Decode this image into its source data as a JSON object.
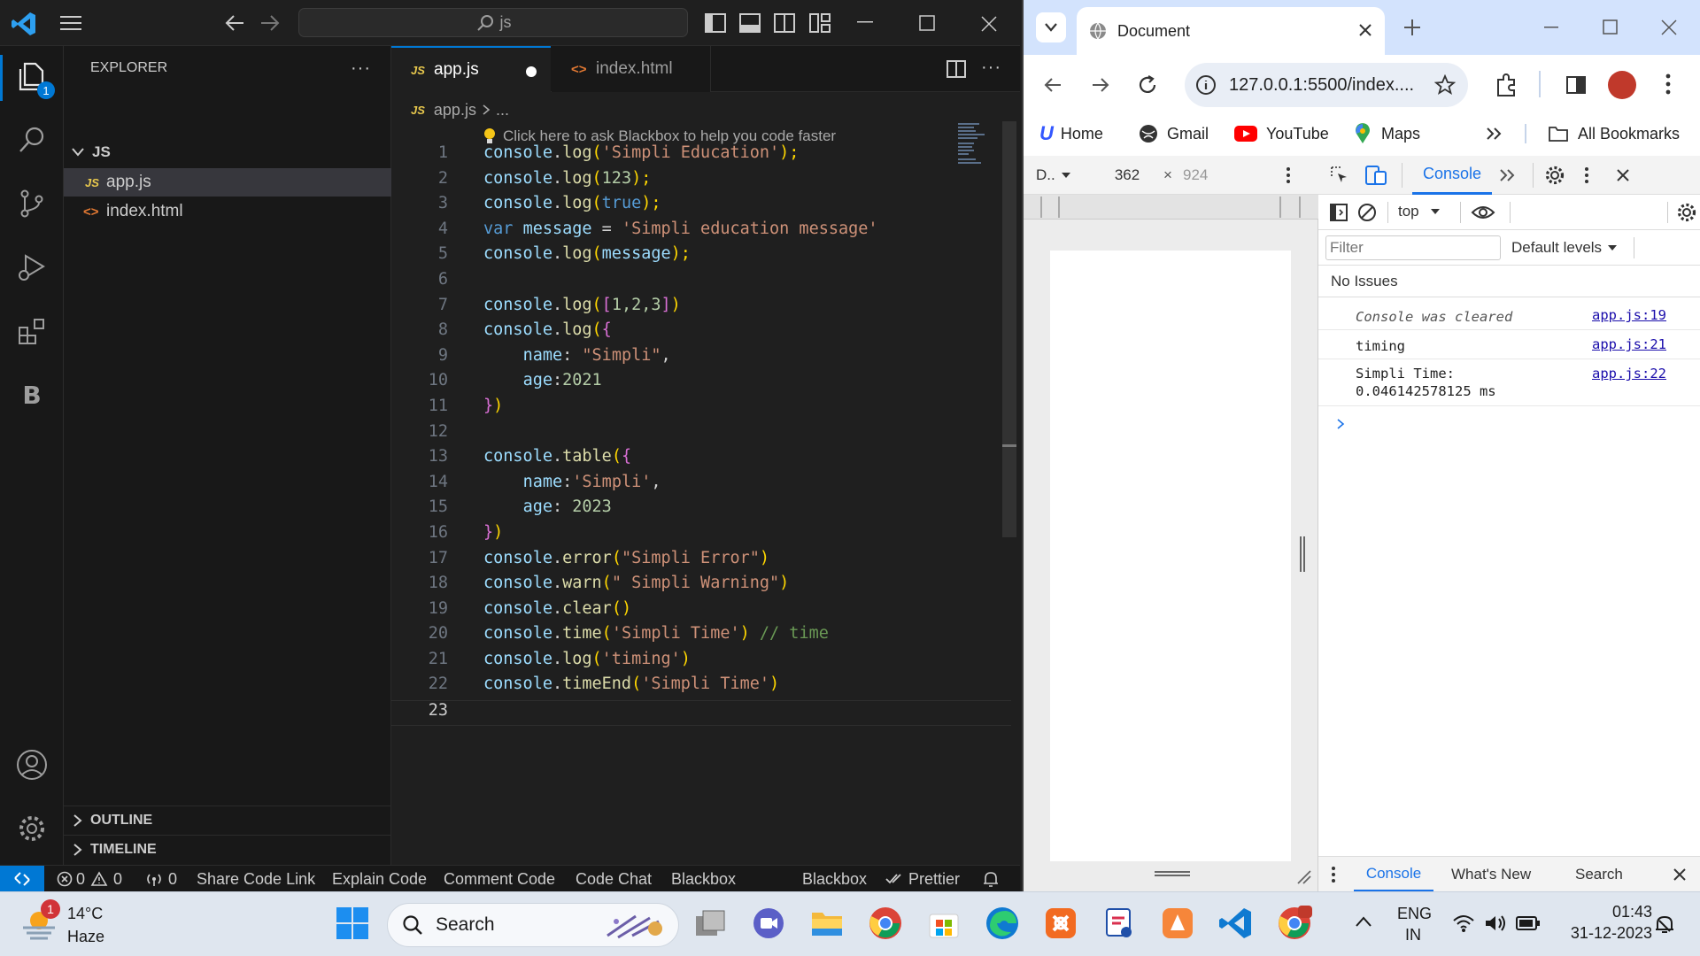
{
  "vscode": {
    "search_text": "js",
    "explorer_title": "EXPLORER",
    "explorer_badge": "1",
    "folder": "JS",
    "files": [
      {
        "icon": "JS",
        "name": "app.js"
      },
      {
        "icon": "<>",
        "name": "index.html"
      }
    ],
    "outline": "OUTLINE",
    "timeline": "TIMELINE",
    "tabs": [
      {
        "icon": "JS",
        "name": "app.js"
      },
      {
        "icon": "<>",
        "name": "index.html"
      }
    ],
    "breadcrumb_icon": "JS",
    "breadcrumb_file": "app.js",
    "breadcrumb_rest": "...",
    "blackbox_hint": "Click here to ask Blackbox to help you code faster",
    "line_numbers": [
      "1",
      "2",
      "3",
      "4",
      "5",
      "6",
      "7",
      "8",
      "9",
      "10",
      "11",
      "12",
      "13",
      "14",
      "15",
      "16",
      "17",
      "18",
      "19",
      "20",
      "21",
      "22",
      "23"
    ],
    "code": {
      "l1": [
        "console",
        ".",
        "log",
        "(",
        "'Simpli Education'",
        ");"
      ],
      "l2": [
        "console",
        ".",
        "log",
        "(",
        "123",
        ");"
      ],
      "l3": [
        "console",
        ".",
        "log",
        "(",
        "true",
        ");"
      ],
      "l4": [
        "var",
        " ",
        "message",
        " = ",
        "'Simpli education message'"
      ],
      "l5": [
        "console",
        ".",
        "log",
        "(",
        "message",
        ");"
      ],
      "l7": [
        "console",
        ".",
        "log",
        "(",
        "[",
        "1,2,3",
        "]",
        ")"
      ],
      "l8": [
        "console",
        ".",
        "log",
        "(",
        "{"
      ],
      "l9": [
        "    ",
        "name",
        ": ",
        "\"Simpli\"",
        ","
      ],
      "l10": [
        "    ",
        "age",
        ":",
        "2021"
      ],
      "l11": [
        "}",
        ")"
      ],
      "l13": [
        "console",
        ".",
        "table",
        "(",
        "{"
      ],
      "l14": [
        "    ",
        "name",
        ":",
        "'Simpli'",
        ","
      ],
      "l15": [
        "    ",
        "age",
        ": ",
        "2023"
      ],
      "l16": [
        "}",
        ")"
      ],
      "l17": [
        "console",
        ".",
        "error",
        "(",
        "\"Simpli Error\"",
        ")"
      ],
      "l18": [
        "console",
        ".",
        "warn",
        "(",
        "\" Simpli Warning\"",
        ")"
      ],
      "l19": [
        "console",
        ".",
        "clear",
        "()"
      ],
      "l20": [
        "console",
        ".",
        "time",
        "(",
        "'Simpli Time'",
        ") ",
        "// time"
      ],
      "l21": [
        "console",
        ".",
        "log",
        "(",
        "'timing'",
        ")"
      ],
      "l22": [
        "console",
        ".",
        "timeEnd",
        "(",
        "'Simpli Time'",
        ")"
      ]
    },
    "status": {
      "errors": "0",
      "warnings": "0",
      "ports": "0",
      "items": [
        "Share Code Link",
        "Explain Code",
        "Comment Code",
        "Code Chat",
        "Blackbox"
      ],
      "right_blackbox": "Blackbox",
      "prettier": "Prettier"
    }
  },
  "browser": {
    "tab_title": "Document",
    "url": "127.0.0.1:5500/index....",
    "bookmarks": [
      "Home",
      "Gmail",
      "YouTube",
      "Maps"
    ],
    "all_bookmarks": "All Bookmarks",
    "device": {
      "label": "D..",
      "width": "362",
      "times": "×",
      "height": "924"
    },
    "devtools": {
      "console_tab": "Console",
      "context": "top",
      "filter_placeholder": "Filter",
      "levels": "Default levels",
      "issues": "No Issues",
      "logs": [
        {
          "text": "Console was cleared",
          "src": "app.js:19"
        },
        {
          "text": "timing",
          "src": "app.js:21"
        },
        {
          "text": "Simpli Time:",
          "text2": "0.046142578125 ms",
          "src": "app.js:22"
        }
      ],
      "drawer_tabs": [
        "Console",
        "What's New",
        "Search"
      ]
    }
  },
  "taskbar": {
    "temperature": "14°C",
    "weather": "Haze",
    "weather_badge": "1",
    "search": "Search",
    "lang1": "ENG",
    "lang2": "IN",
    "time": "01:43",
    "date": "31-12-2023"
  },
  "colors": {
    "vs_bg": "#1f1f1f",
    "accent": "#0078d4",
    "console_tab": "#1a73e8"
  }
}
